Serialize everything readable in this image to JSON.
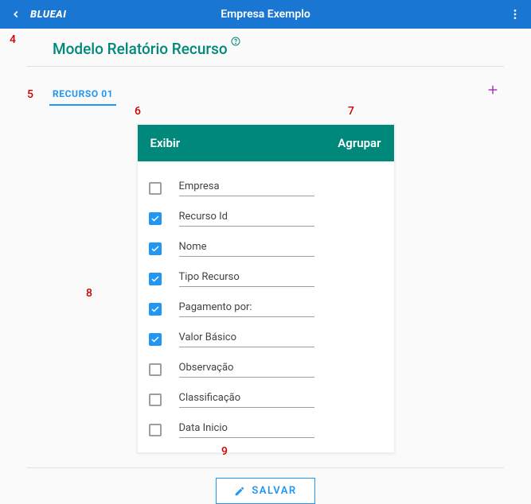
{
  "header": {
    "logo_text": "BLUEAI",
    "title": "Empresa Exemplo"
  },
  "page": {
    "title": "Modelo Relatório Recurso"
  },
  "tabs": {
    "active": "RECURSO 01"
  },
  "annotations": {
    "a4": "4",
    "a5": "5",
    "a6": "6",
    "a7": "7",
    "a8": "8",
    "a9": "9"
  },
  "card": {
    "header_left": "Exibir",
    "header_right": "Agrupar",
    "fields": [
      {
        "label": "Empresa",
        "checked": false
      },
      {
        "label": "Recurso Id",
        "checked": true
      },
      {
        "label": "Nome",
        "checked": true
      },
      {
        "label": "Tipo Recurso",
        "checked": true
      },
      {
        "label": "Pagamento por:",
        "checked": true
      },
      {
        "label": "Valor Básico",
        "checked": true
      },
      {
        "label": "Observação",
        "checked": false
      },
      {
        "label": "Classificação",
        "checked": false
      },
      {
        "label": "Data Inicio",
        "checked": false
      }
    ]
  },
  "actions": {
    "save": "SALVAR"
  }
}
